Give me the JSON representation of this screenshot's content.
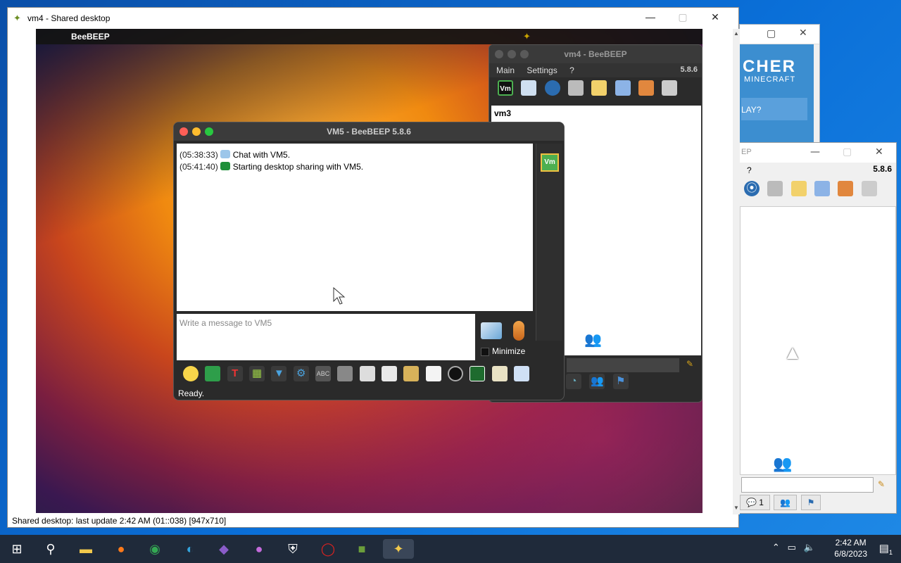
{
  "shared_window": {
    "title": "vm4 - Shared desktop",
    "status": "Shared desktop: last update 2:42 AM (01::038) [947x710]"
  },
  "mac": {
    "menubar_app": "BeeBEEP",
    "bg_window": {
      "title": "vm4 - BeeBEEP",
      "menu": [
        "Main",
        "Settings",
        "?"
      ],
      "version": "5.8.6",
      "user_partial": "vm3",
      "vm_button": "Vm"
    },
    "chat_window": {
      "title": "VM5 - BeeBEEP 5.8.6",
      "messages": [
        {
          "time": "(05:38:33)",
          "text": "Chat with VM5."
        },
        {
          "time": "(05:41:40)",
          "text": "Starting desktop sharing with VM5."
        }
      ],
      "placeholder": "Write a message to VM5",
      "minimize_label": "Minimize",
      "status": "Ready.",
      "user_avatar": "Vm"
    }
  },
  "minecraft_window": {
    "title_partial": "CHER",
    "subtitle": "MINECRAFT",
    "play_partial": "LAY?"
  },
  "right_window": {
    "title_partial": "EP",
    "menu_partial": "?",
    "version": "5.8.6",
    "tab_count": "1"
  },
  "taskbar": {
    "time": "2:42 AM",
    "date": "6/8/2023",
    "notification_count": "1"
  },
  "colors": {
    "desktop_blue": "#0a63c9",
    "taskbar": "#1f2a3a",
    "mac_close": "#ff5f57",
    "mac_min": "#febc2e",
    "mac_max": "#28c840"
  }
}
